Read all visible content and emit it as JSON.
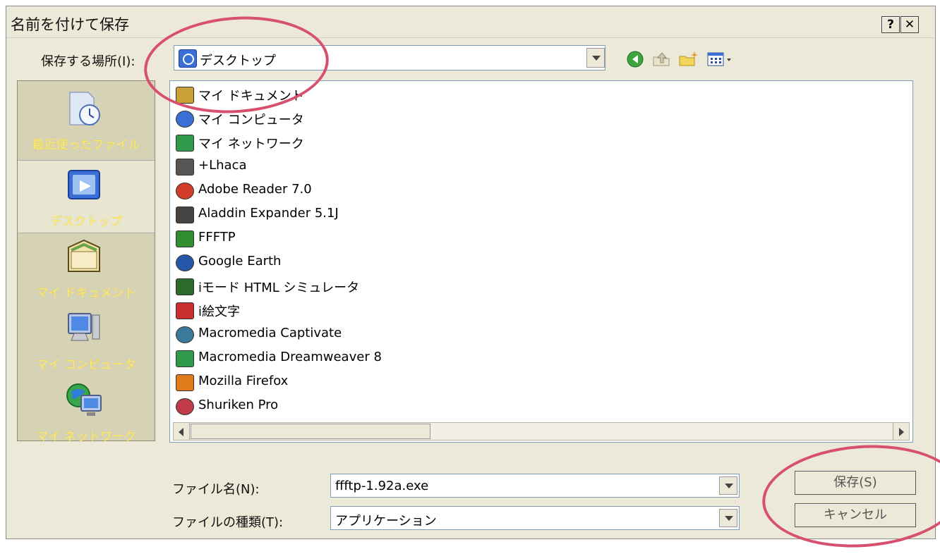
{
  "window": {
    "title": "名前を付けて保存",
    "help_glyph": "?",
    "close_glyph": "✕"
  },
  "save_in": {
    "label": "保存する場所(I):",
    "value": "デスクトップ"
  },
  "toolbar": {
    "icons": [
      "back-icon",
      "up-folder-icon",
      "new-folder-icon",
      "views-menu-icon"
    ]
  },
  "places": [
    {
      "label": "最近使ったファイル",
      "icon": "recent-files-icon",
      "selected": false
    },
    {
      "label": "デスクトップ",
      "icon": "desktop-icon",
      "selected": true
    },
    {
      "label": "マイ ドキュメント",
      "icon": "my-documents-icon",
      "selected": false
    },
    {
      "label": "マイ コンピュータ",
      "icon": "my-computer-icon",
      "selected": false
    },
    {
      "label": "マイ ネットワーク",
      "icon": "my-network-icon",
      "selected": false
    }
  ],
  "files": [
    {
      "name": "マイ ドキュメント",
      "icon": "folder-documents-icon"
    },
    {
      "name": "マイ コンピュータ",
      "icon": "computer-icon"
    },
    {
      "name": "マイ ネットワーク",
      "icon": "network-icon"
    },
    {
      "name": "+Lhaca",
      "icon": "lhaca-icon"
    },
    {
      "name": "Adobe Reader 7.0",
      "icon": "adobe-reader-icon"
    },
    {
      "name": "Aladdin Expander 5.1J",
      "icon": "aladdin-icon"
    },
    {
      "name": "FFFTP",
      "icon": "ffftp-icon"
    },
    {
      "name": "Google Earth",
      "icon": "google-earth-icon"
    },
    {
      "name": "iモード HTML シミュレータ",
      "icon": "imode-icon"
    },
    {
      "name": "i絵文字",
      "icon": "emoji-icon"
    },
    {
      "name": "Macromedia Captivate",
      "icon": "captivate-icon"
    },
    {
      "name": "Macromedia Dreamweaver 8",
      "icon": "dreamweaver-icon"
    },
    {
      "name": "Mozilla Firefox",
      "icon": "firefox-icon"
    },
    {
      "name": "Shuriken Pro",
      "icon": "shuriken-icon"
    }
  ],
  "file_name": {
    "label": "ファイル名(N):",
    "value": "ffftp-1.92a.exe"
  },
  "file_type": {
    "label": "ファイルの種類(T):",
    "value": "アプリケーション"
  },
  "buttons": {
    "save": "保存(S)",
    "cancel": "キャンセル"
  },
  "colors": {
    "dialog_bg": "#ece9d8",
    "places_bg": "#d6d2b5",
    "places_text": "#ffe86a",
    "annotation": "#d7506e"
  }
}
